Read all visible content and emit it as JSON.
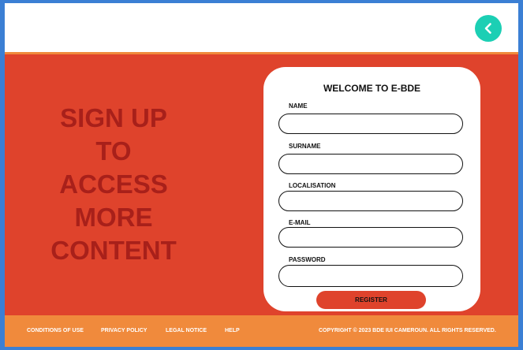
{
  "header": {
    "back_icon": "chevron-left-icon",
    "accent_color": "#1ccfb4"
  },
  "hero": {
    "background_color": "#df432c",
    "slogan_lines": [
      "SIGN UP",
      "TO",
      "ACCESS",
      "MORE",
      "CONTENT"
    ],
    "slogan_color": "#a8201a"
  },
  "form": {
    "title": "WELCOME TO E-BDE",
    "fields": [
      {
        "label": "NAME",
        "value": ""
      },
      {
        "label": "SURNAME",
        "value": ""
      },
      {
        "label": "LOCALISATION",
        "value": ""
      },
      {
        "label": "E-MAIL",
        "value": ""
      },
      {
        "label": "PASSWORD",
        "value": ""
      }
    ],
    "register_label": "REGISTER"
  },
  "footer": {
    "background_color": "#f08a3c",
    "links": [
      "CONDITIONS OF USE",
      "PRIVACY POLICY",
      "LEGAL NOTICE",
      "HELP"
    ],
    "copyright": "COPYRIGHT © 2023 BDE IUI CAMEROUN. ALL RIGHTS RESERVED."
  }
}
